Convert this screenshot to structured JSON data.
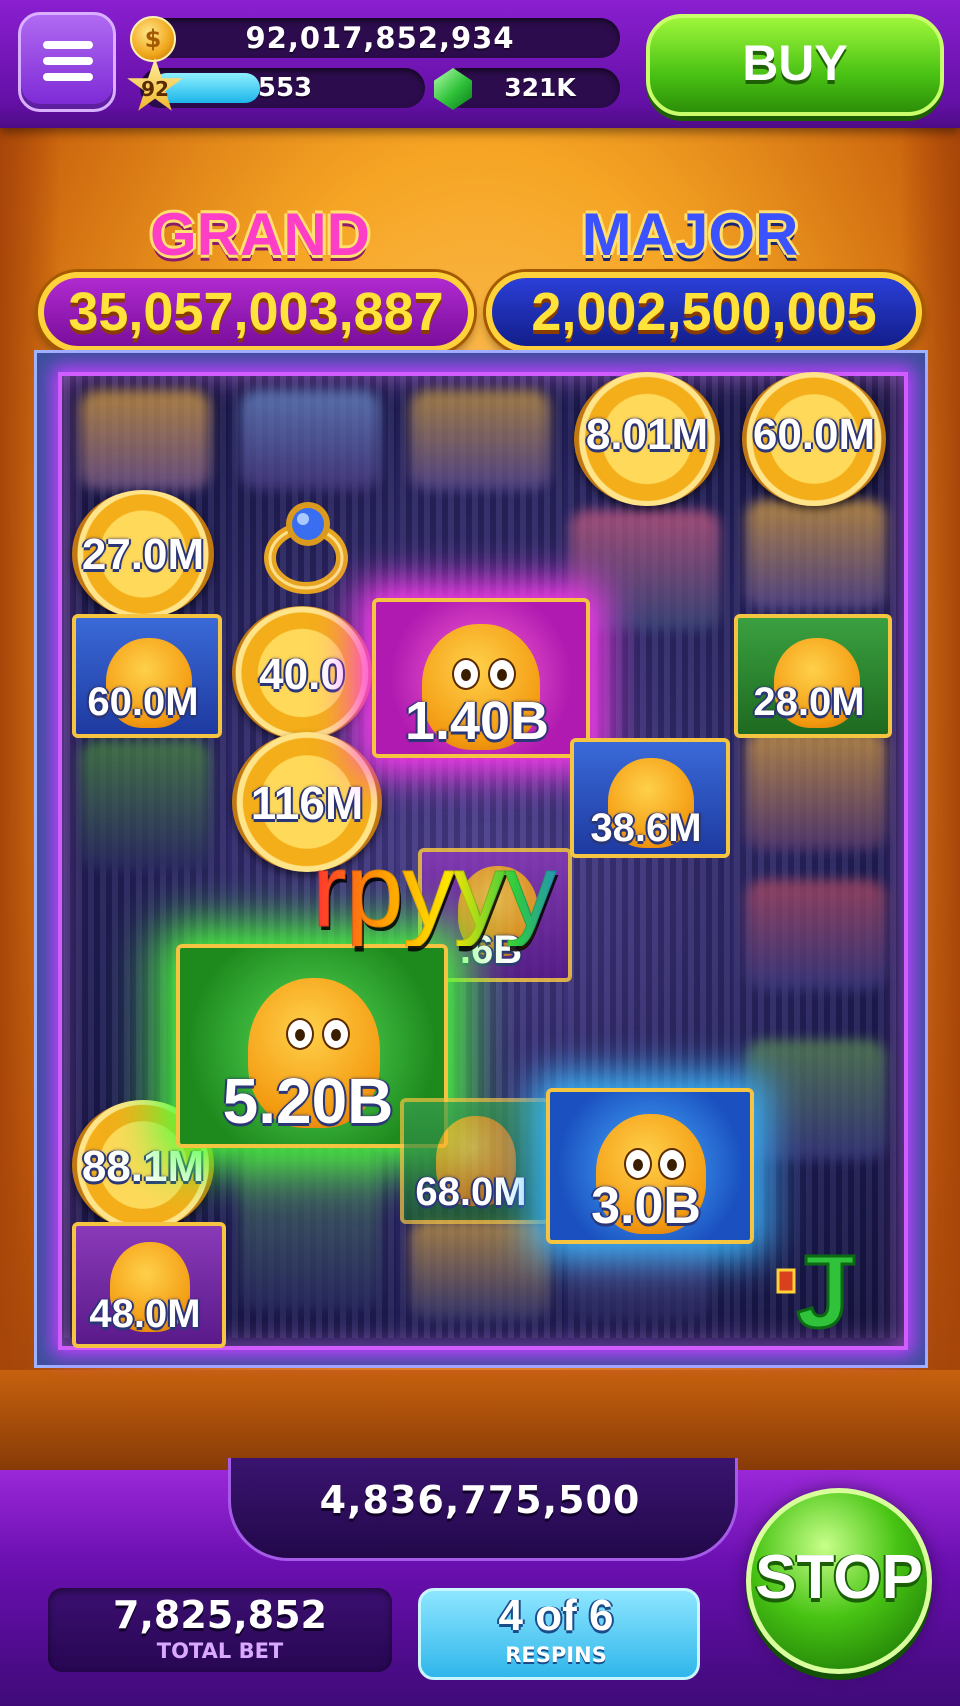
{
  "header": {
    "coins": "92,017,852,934",
    "level": "92",
    "xp": "553",
    "xp_progress": 0.4,
    "gems": "321K",
    "buy_label": "BUY"
  },
  "jackpots": {
    "grand_label": "GRAND",
    "grand_value": "35,057,003,887",
    "major_label": "MAJOR",
    "major_value": "2,002,500,005"
  },
  "board": {
    "coins": [
      "8.01M",
      "60.0M",
      "27.0M",
      "40.0",
      "116M",
      "88.1M"
    ],
    "tiles": [
      "60.0M",
      "1.40B",
      "28.0M",
      "38.6M",
      ".6B",
      "5.20B",
      "68.0M",
      "3.0B",
      "48.0M"
    ],
    "overlay_text": "rpyyy"
  },
  "footer": {
    "win_amount": "4,836,775,500",
    "total_bet": "7,825,852",
    "total_bet_label": "TOTAL BET",
    "respins": "4 of 6",
    "respins_label": "RESPINS",
    "stop_label": "STOP"
  },
  "colors": {
    "accent_purple": "#7b1fc2",
    "buy_green": "#4ac214",
    "grand_pink": "#ff3ec8",
    "major_blue": "#3a52ff",
    "jackpot_gold": "#ffe23a"
  }
}
